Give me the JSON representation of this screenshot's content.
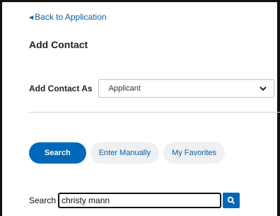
{
  "nav": {
    "back_label": "Back to Application"
  },
  "page": {
    "title": "Add Contact"
  },
  "add_contact_as": {
    "label": "Add Contact As",
    "selected": "Applicant"
  },
  "actions": {
    "search": "Search",
    "enter_manually": "Enter Manually",
    "my_favorites": "My Favorites"
  },
  "search": {
    "label": "Search",
    "value": "christy mann"
  },
  "colors": {
    "primary": "#0068b8",
    "link": "#0b5fa5",
    "pill_bg": "#eef0f2"
  }
}
